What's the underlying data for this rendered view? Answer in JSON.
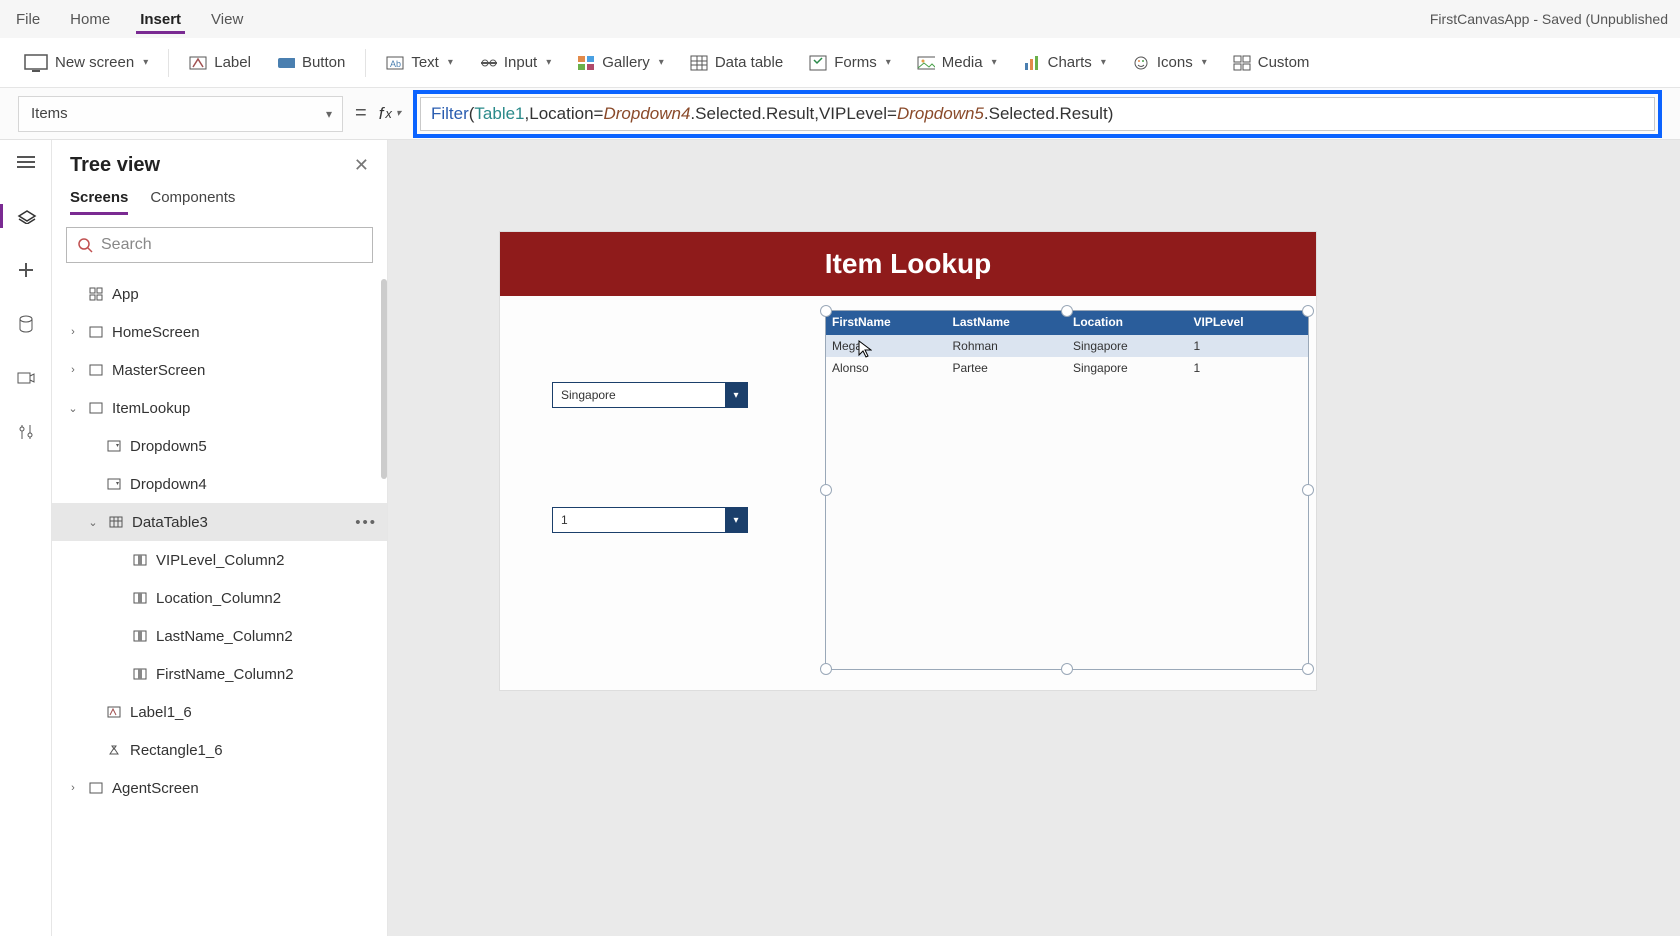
{
  "app_title": "FirstCanvasApp - Saved (Unpublished",
  "menu": {
    "file": "File",
    "home": "Home",
    "insert": "Insert",
    "view": "View",
    "active": "Insert"
  },
  "ribbon": {
    "new_screen": "New screen",
    "label": "Label",
    "button": "Button",
    "text": "Text",
    "input": "Input",
    "gallery": "Gallery",
    "data_table": "Data table",
    "forms": "Forms",
    "media": "Media",
    "charts": "Charts",
    "icons": "Icons",
    "custom": "Custom"
  },
  "property_selector": "Items",
  "formula": {
    "fn": "Filter",
    "table": "Table1",
    "field1": "Location",
    "dd1": "Dropdown4",
    "sel": ".Selected.Result",
    "field2": "VIPLevel",
    "dd2": "Dropdown5"
  },
  "tree": {
    "title": "Tree view",
    "tabs": {
      "screens": "Screens",
      "components": "Components"
    },
    "search_placeholder": "Search",
    "app": "App",
    "home_screen": "HomeScreen",
    "master_screen": "MasterScreen",
    "item_lookup": "ItemLookup",
    "dropdown5": "Dropdown5",
    "dropdown4": "Dropdown4",
    "datatable3": "DataTable3",
    "vip_col": "VIPLevel_Column2",
    "loc_col": "Location_Column2",
    "last_col": "LastName_Column2",
    "first_col": "FirstName_Column2",
    "label1_6": "Label1_6",
    "rect1_6": "Rectangle1_6",
    "agent_screen": "AgentScreen"
  },
  "canvas": {
    "title": "Item Lookup",
    "dd_location_value": "Singapore",
    "dd_vip_value": "1",
    "cols": {
      "c1": "FirstName",
      "c2": "LastName",
      "c3": "Location",
      "c4": "VIPLevel"
    },
    "rows": [
      {
        "first": "Mega",
        "last": "Rohman",
        "loc": "Singapore",
        "vip": "1"
      },
      {
        "first": "Alonso",
        "last": "Partee",
        "loc": "Singapore",
        "vip": "1"
      }
    ]
  }
}
